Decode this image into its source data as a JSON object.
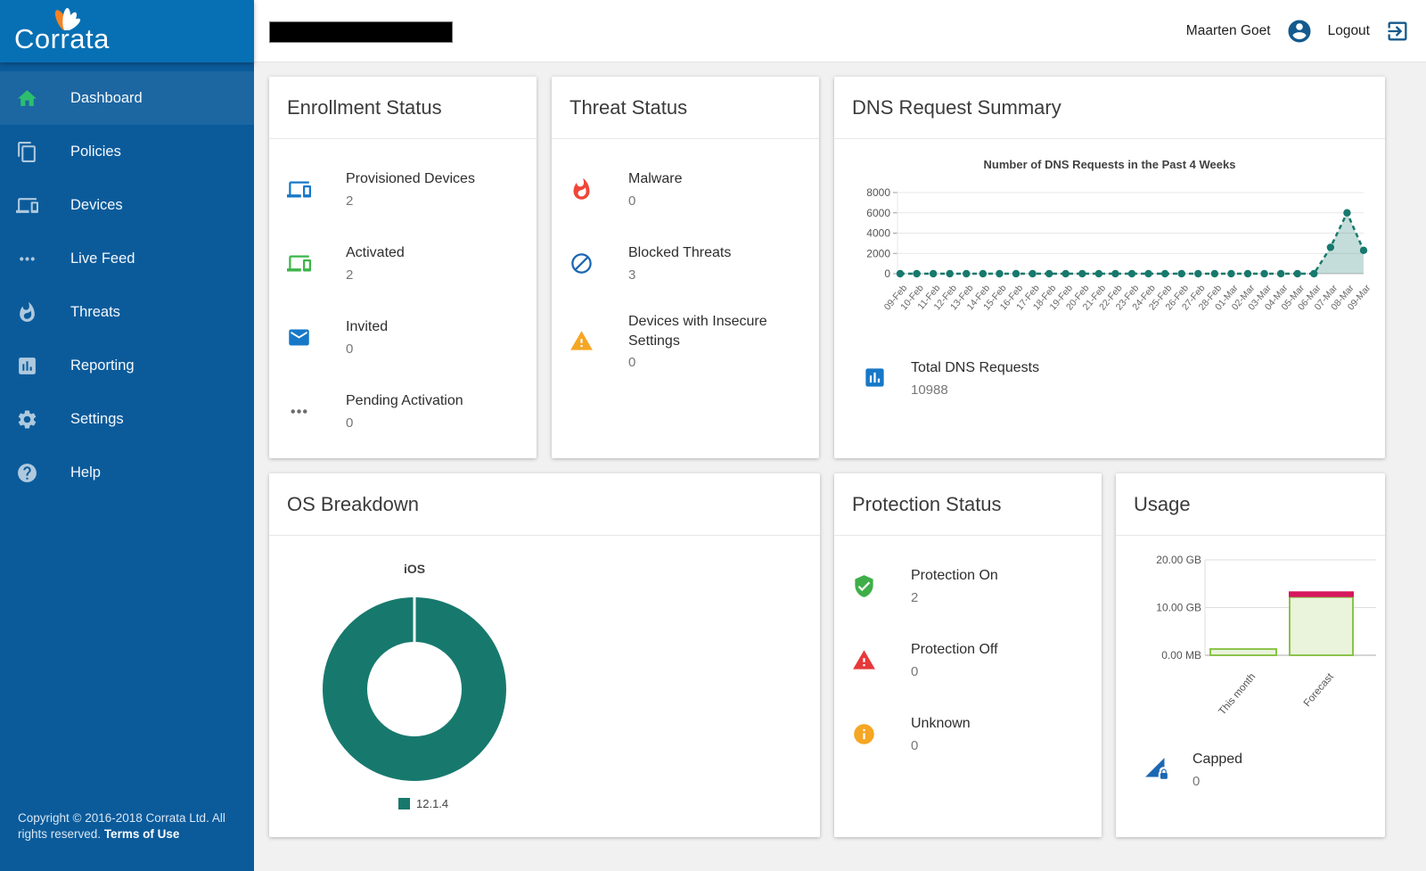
{
  "brand": {
    "name": "Corrata"
  },
  "header": {
    "user_name": "Maarten Goet",
    "logout_label": "Logout"
  },
  "sidebar": {
    "items": [
      {
        "label": "Dashboard"
      },
      {
        "label": "Policies"
      },
      {
        "label": "Devices"
      },
      {
        "label": "Live Feed"
      },
      {
        "label": "Threats"
      },
      {
        "label": "Reporting"
      },
      {
        "label": "Settings"
      },
      {
        "label": "Help"
      }
    ],
    "copyright": "Copyright © 2016-2018 Corrata Ltd. All rights reserved.",
    "terms_label": "Terms of Use"
  },
  "cards": {
    "enrollment": {
      "title": "Enrollment Status",
      "items": [
        {
          "label": "Provisioned Devices",
          "value": "2"
        },
        {
          "label": "Activated",
          "value": "2"
        },
        {
          "label": "Invited",
          "value": "0"
        },
        {
          "label": "Pending Activation",
          "value": "0"
        }
      ]
    },
    "threat": {
      "title": "Threat Status",
      "items": [
        {
          "label": "Malware",
          "value": "0"
        },
        {
          "label": "Blocked Threats",
          "value": "3"
        },
        {
          "label": "Devices with Insecure Settings",
          "value": "0"
        }
      ]
    },
    "dns": {
      "title": "DNS Request Summary",
      "total_label": "Total DNS Requests",
      "total_value": "10988"
    },
    "os": {
      "title": "OS Breakdown"
    },
    "protection": {
      "title": "Protection Status",
      "items": [
        {
          "label": "Protection On",
          "value": "2"
        },
        {
          "label": "Protection Off",
          "value": "0"
        },
        {
          "label": "Unknown",
          "value": "0"
        }
      ]
    },
    "usage": {
      "title": "Usage",
      "capped_label": "Capped",
      "capped_value": "0"
    }
  },
  "colors": {
    "sidebar_top": "#0770B4",
    "sidebar": "#0B5B9B",
    "teal": "#17796D",
    "icon_blue": "#1778C8",
    "icon_dark_blue": "#1B67B3",
    "icon_green": "#3CB54A",
    "shield_green": "#3FAE49",
    "flame_red": "#EF4638",
    "triangle_red": "#E6393B",
    "warn_orange": "#F6A623",
    "header_blue": "#155A8E",
    "bar_fill": "#EAF3DC",
    "bar_stroke": "#8BC34A",
    "cap_pink": "#D6175E"
  },
  "chart_data": [
    {
      "id": "dns",
      "type": "line",
      "title": "Number of DNS Requests in the Past 4 Weeks",
      "x": [
        "09-Feb",
        "10-Feb",
        "11-Feb",
        "12-Feb",
        "13-Feb",
        "14-Feb",
        "15-Feb",
        "16-Feb",
        "17-Feb",
        "18-Feb",
        "19-Feb",
        "20-Feb",
        "21-Feb",
        "22-Feb",
        "23-Feb",
        "24-Feb",
        "25-Feb",
        "26-Feb",
        "27-Feb",
        "28-Feb",
        "01-Mar",
        "02-Mar",
        "03-Mar",
        "04-Mar",
        "05-Mar",
        "06-Mar",
        "07-Mar",
        "08-Mar",
        "09-Mar"
      ],
      "values": [
        0,
        0,
        0,
        0,
        0,
        0,
        0,
        0,
        0,
        0,
        0,
        0,
        0,
        0,
        0,
        0,
        0,
        0,
        0,
        0,
        0,
        0,
        0,
        0,
        0,
        0,
        2600,
        6000,
        2300
      ],
      "ylim": [
        0,
        8000
      ],
      "yticks": [
        0,
        2000,
        4000,
        6000,
        8000
      ],
      "grid": true,
      "dashed": true,
      "line_color": "#17796D",
      "fill_color": "rgba(23,121,109,0.25)"
    },
    {
      "id": "os",
      "type": "pie",
      "donut": true,
      "title": "iOS",
      "labels": [
        "12.1.4"
      ],
      "values": [
        100
      ],
      "colors": [
        "#17796D"
      ],
      "legend_position": "bottom"
    },
    {
      "id": "usage",
      "type": "bar",
      "categories": [
        "This month",
        "Forecast"
      ],
      "values_gb": [
        1.3,
        12.2
      ],
      "cap_gb": [
        0,
        1.2
      ],
      "ylim": [
        0,
        20
      ],
      "yticks": [
        {
          "v": 0,
          "label": "0.00 MB"
        },
        {
          "v": 10,
          "label": "10.00 GB"
        },
        {
          "v": 20,
          "label": "20.00 GB"
        }
      ],
      "bar_fill": "#EAF3DC",
      "bar_stroke": "#8BC34A",
      "cap_color": "#D6175E"
    }
  ]
}
